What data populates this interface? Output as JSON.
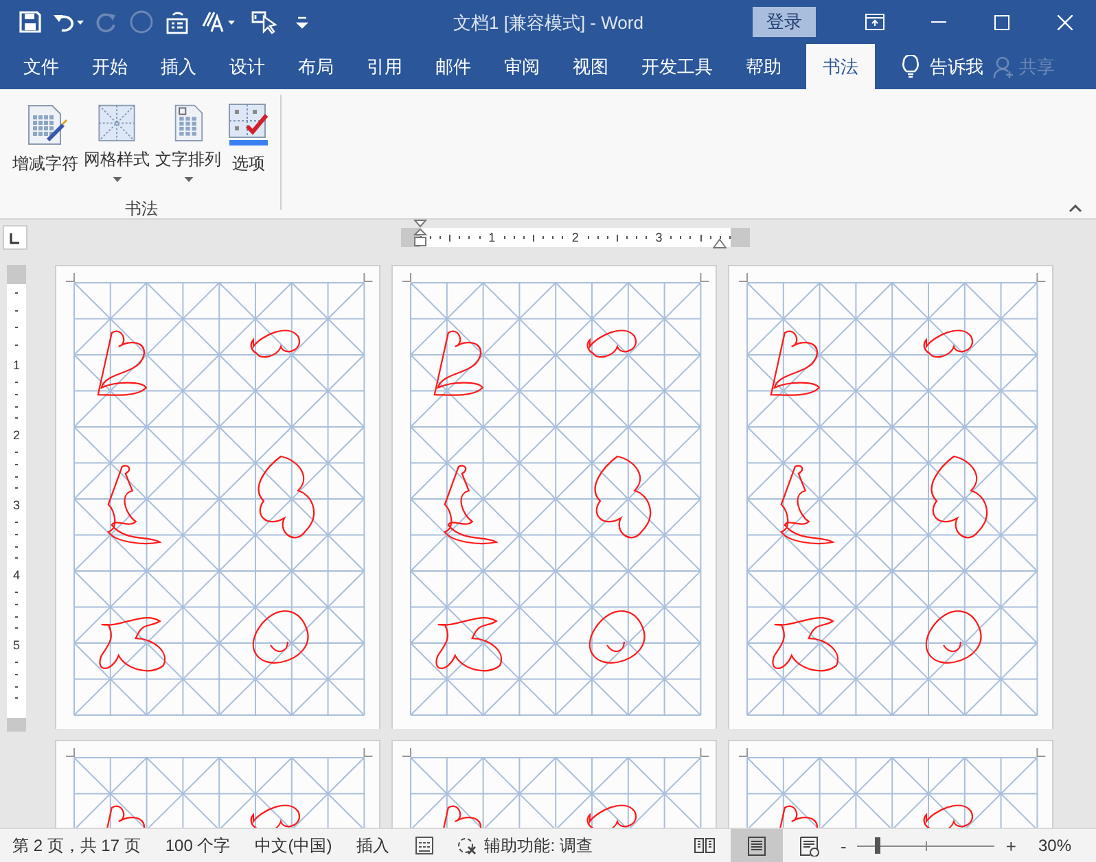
{
  "window": {
    "title": "文档1 [兼容模式]  -  Word",
    "login": "登录"
  },
  "tabs": [
    {
      "label": "文件",
      "selected": false
    },
    {
      "label": "开始",
      "selected": false
    },
    {
      "label": "插入",
      "selected": false
    },
    {
      "label": "设计",
      "selected": false
    },
    {
      "label": "布局",
      "selected": false
    },
    {
      "label": "引用",
      "selected": false
    },
    {
      "label": "邮件",
      "selected": false
    },
    {
      "label": "审阅",
      "selected": false
    },
    {
      "label": "视图",
      "selected": false
    },
    {
      "label": "开发工具",
      "selected": false
    },
    {
      "label": "帮助",
      "selected": false
    },
    {
      "label": "书法",
      "selected": true
    }
  ],
  "tell_me": "告诉我",
  "share": {
    "label": "共享",
    "disabled": true
  },
  "ribbon": {
    "group": "书法",
    "buttons": [
      {
        "label": "增减字符",
        "kind": "chars",
        "dropdown": false
      },
      {
        "label": "网格样式",
        "kind": "grid",
        "dropdown": true
      },
      {
        "label": "文字排列",
        "kind": "arrange",
        "dropdown": true
      },
      {
        "label": "选项",
        "kind": "options",
        "dropdown": false
      }
    ]
  },
  "ruler": {
    "marks": [
      "1",
      "2",
      "3"
    ],
    "vertical_marks": [
      "1",
      "2",
      "3",
      "4",
      "5"
    ]
  },
  "pages": [
    {
      "kind": "full"
    },
    {
      "kind": "full"
    },
    {
      "kind": "full"
    },
    {
      "kind": "cut"
    },
    {
      "kind": "cut"
    },
    {
      "kind": "cut"
    }
  ],
  "status_bar": {
    "page": "第 2 页，共 17 页",
    "words": "100 个字",
    "language": "中文(中国)",
    "mode": "插入",
    "accessibility": "辅助功能: 调查",
    "views": [
      {
        "kind": "read",
        "selected": false
      },
      {
        "kind": "print",
        "selected": true
      },
      {
        "kind": "web",
        "selected": false
      }
    ],
    "zoom_out": "-",
    "zoom_in": "+",
    "zoom": {
      "level": 0.15
    },
    "zoom_text": "30%"
  }
}
